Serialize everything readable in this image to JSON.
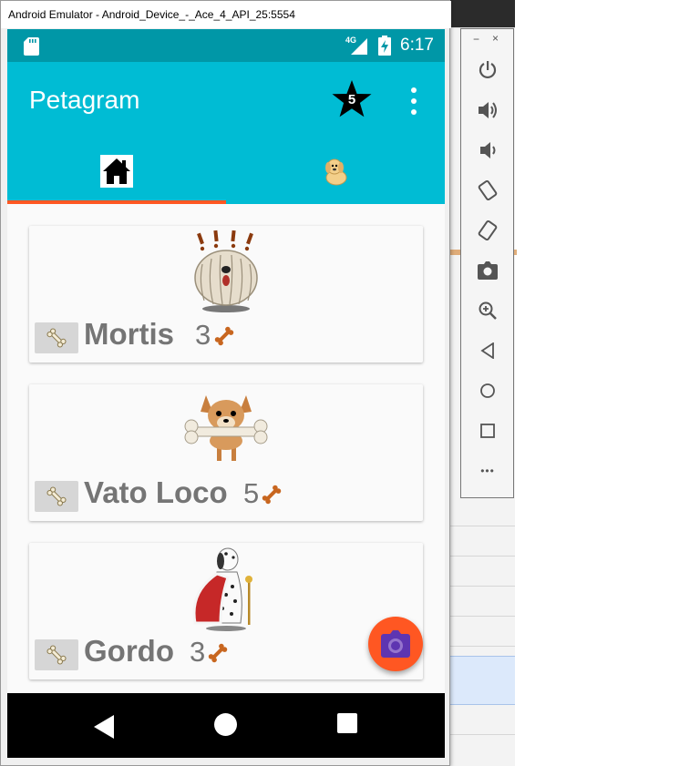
{
  "window": {
    "title": "Android Emulator - Android_Device_-_Ace_4_API_25:5554"
  },
  "statusbar": {
    "network": "4G",
    "time": "6:17",
    "icons": [
      "sd-card-icon",
      "signal-icon",
      "battery-charging-icon"
    ]
  },
  "appbar": {
    "title": "Petagram",
    "favorites_count": "5",
    "color": "#00bcd4",
    "status_color": "#0097a7",
    "accent": "#ff5722"
  },
  "tabs": [
    {
      "name": "home",
      "icon": "house-icon",
      "selected": true
    },
    {
      "name": "profile",
      "icon": "dog-icon",
      "selected": false
    }
  ],
  "pets": [
    {
      "name": "Mortis",
      "rating": "3",
      "picture": "shaggy-dog-icon"
    },
    {
      "name": "Vato Loco",
      "rating": "5",
      "picture": "chihuahua-bone-icon"
    },
    {
      "name": "Gordo",
      "rating": "3",
      "picture": "dalmatian-king-icon"
    }
  ],
  "fab": {
    "icon": "camera-icon"
  },
  "navbar": {
    "buttons": [
      "back-icon",
      "home-icon",
      "recents-icon"
    ]
  },
  "sidebar": {
    "minimize": "−",
    "close": "×",
    "more": "•••",
    "buttons": [
      "power-icon",
      "volume-up-icon",
      "volume-down-icon",
      "rotate-left-icon",
      "rotate-right-icon",
      "camera-icon",
      "zoom-icon",
      "back-icon",
      "home-icon",
      "overview-icon",
      "more-icon"
    ]
  }
}
